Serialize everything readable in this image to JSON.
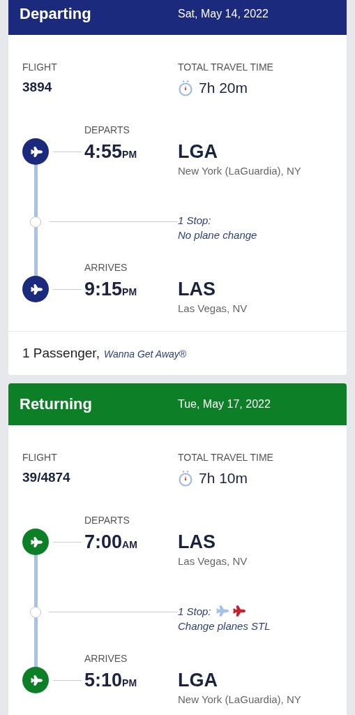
{
  "legs": [
    {
      "title": "Departing",
      "date": "Sat, May 14, 2022",
      "color": "#1b2a7c",
      "flight_label": "FLIGHT",
      "flight": "3894",
      "travel_label": "TOTAL TRAVEL TIME",
      "travel_time": "7h 20m",
      "depart": {
        "label": "DEPARTS",
        "time": "4:55",
        "meridiem": "PM",
        "code": "LGA",
        "city": "New York (LaGuardia), NY"
      },
      "stop": {
        "line1": "1 Stop:",
        "line2": "No plane change",
        "plane_change": false
      },
      "arrive": {
        "label": "ARRIVES",
        "time": "9:15",
        "meridiem": "PM",
        "code": "LAS",
        "city": "Las Vegas, NV"
      },
      "passengers": "1 Passenger,",
      "fare": "Wanna Get Away®"
    },
    {
      "title": "Returning",
      "date": "Tue, May 17, 2022",
      "color": "#0d7f27",
      "flight_label": "FLIGHT",
      "flight": "39/4874",
      "travel_label": "TOTAL TRAVEL TIME",
      "travel_time": "7h 10m",
      "depart": {
        "label": "DEPARTS",
        "time": "7:00",
        "meridiem": "AM",
        "code": "LAS",
        "city": "Las Vegas, NV"
      },
      "stop": {
        "line1": "1 Stop:",
        "line2": "Change planes STL",
        "plane_change": true
      },
      "arrive": {
        "label": "ARRIVES",
        "time": "5:10",
        "meridiem": "PM",
        "code": "LGA",
        "city": "New York (LaGuardia), NY"
      }
    }
  ]
}
